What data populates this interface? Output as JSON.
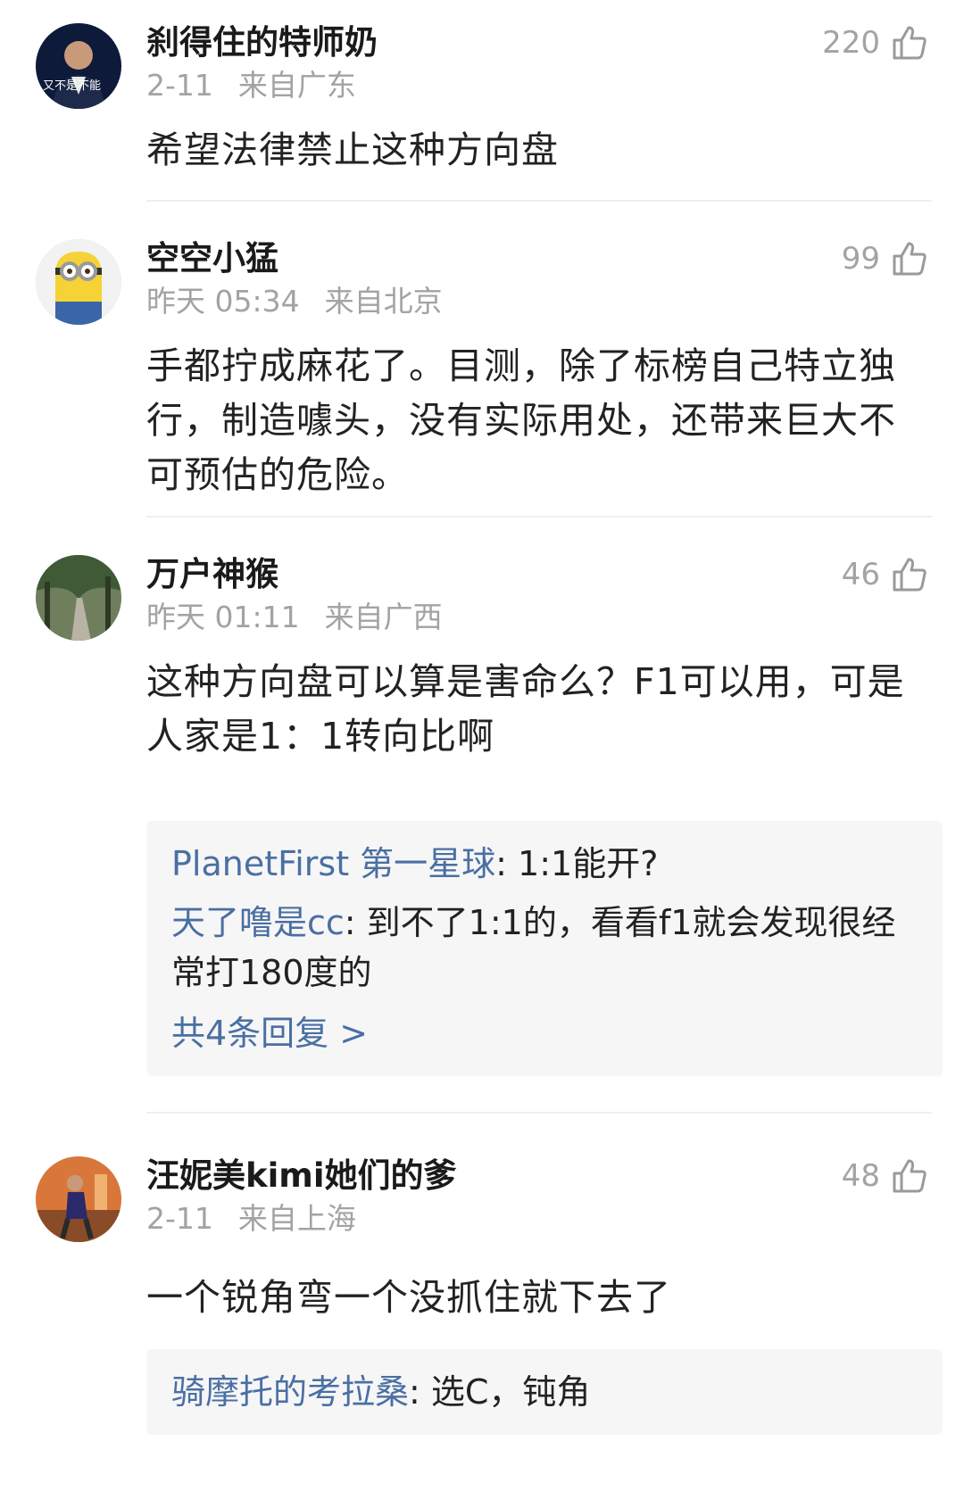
{
  "comments": [
    {
      "username": "刹得住的特师奶",
      "date": "2-11",
      "location": "来自广东",
      "likes": "220",
      "text": "希望法律禁止这种方向盘",
      "avatar_icon": "person-avatar",
      "avatar_caption": "又不是不能"
    },
    {
      "username": "空空小猛",
      "date": "昨天 05:34",
      "location": "来自北京",
      "likes": "99",
      "text": "手都拧成麻花了。目测，除了标榜自己特立独行，制造噱头，没有实际用处，还带来巨大不可预估的危险。",
      "avatar_icon": "minion-avatar"
    },
    {
      "username": "万户神猴",
      "date": "昨天 01:11",
      "location": "来自广西",
      "likes": "46",
      "text": "这种方向盘可以算是害命么？F1可以用，可是人家是1：1转向比啊",
      "avatar_icon": "forest-path-avatar",
      "replies": [
        {
          "name": "PlanetFirst 第一星球",
          "text": ": 1:1能开?"
        },
        {
          "name": "天了噜是cc",
          "text": ": 到不了1:1的，看看f1就会发现很经常打180度的"
        }
      ],
      "more": "共4条回复 >"
    },
    {
      "username": "汪妮美kimi她们的爹",
      "date": "2-11",
      "location": "来自上海",
      "likes": "48",
      "text": "一个锐角弯一个没抓住就下去了",
      "avatar_icon": "gym-avatar",
      "replies": [
        {
          "name": "骑摩托的考拉桑",
          "text": ": 选C，钝角"
        }
      ]
    }
  ],
  "colors": {
    "link": "#4a6fa3",
    "meta": "#a3a3a3",
    "reply_bg": "#f6f6f6"
  }
}
